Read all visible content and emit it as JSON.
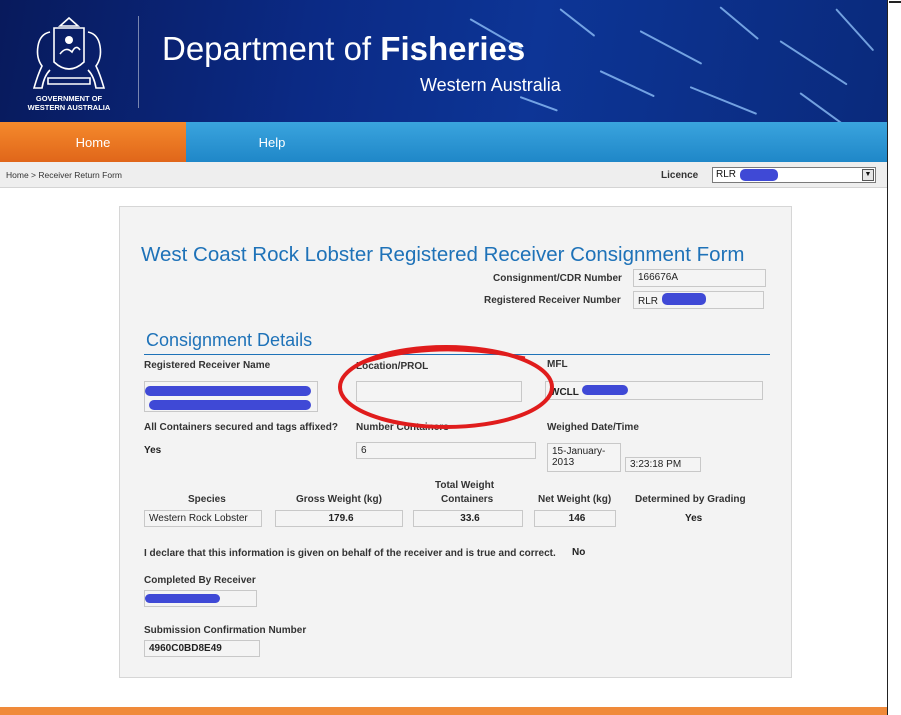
{
  "header": {
    "gov_line1": "GOVERNMENT OF",
    "gov_line2": "WESTERN AUSTRALIA",
    "dept_prefix": "Department of ",
    "dept_bold": "Fisheries",
    "dept_sub": "Western Australia"
  },
  "nav": {
    "home": "Home",
    "help": "Help"
  },
  "breadcrumb": {
    "home": "Home",
    "separator": " > ",
    "current": "Receiver Return Form"
  },
  "licence": {
    "label": "Licence",
    "value": "RLR"
  },
  "form": {
    "title": "West Coast Rock Lobster Registered Receiver Consignment Form",
    "consignment_label": "Consignment/CDR Number",
    "consignment_value": "166676A",
    "receiver_number_label": "Registered Receiver Number",
    "receiver_number_value": "RLR",
    "section_title": "Consignment Details",
    "receiver_name_label": "Registered Receiver Name",
    "location_label": "Location/PROL",
    "location_value": "",
    "mfl_label": "MFL",
    "mfl_value": "WCLL",
    "containers_secured_label": "All Containers secured and tags affixed?",
    "containers_secured_value": "Yes",
    "number_containers_label": "Number Containers",
    "number_containers_value": "6",
    "weighed_label": "Weighed Date/Time",
    "weighed_date_line1": "15-January-",
    "weighed_date_line2": "2013",
    "weighed_time": "3:23:18 PM",
    "species_label": "Species",
    "species_value": "Western Rock Lobster",
    "gross_label": "Gross Weight (kg)",
    "gross_value": "179.6",
    "total_weight_label_1": "Total Weight",
    "total_weight_label_2": "Containers",
    "total_weight_value": "33.6",
    "net_label": "Net Weight (kg)",
    "net_value": "146",
    "grading_label": "Determined by Grading",
    "grading_value": "Yes",
    "declaration_text": "I declare that this information is given on behalf of the receiver and is true and correct.",
    "declaration_value": "No",
    "completed_label": "Completed By Receiver",
    "confirmation_label": "Submission Confirmation Number",
    "confirmation_value": "4960C0BD8E49"
  },
  "colors": {
    "header_blue": "#0b2a85",
    "nav_blue": "#2a93d2",
    "nav_orange": "#ee7b22",
    "title_blue": "#1e72b8",
    "redaction": "#3f49d6",
    "annotation_red": "#e01c1c"
  }
}
